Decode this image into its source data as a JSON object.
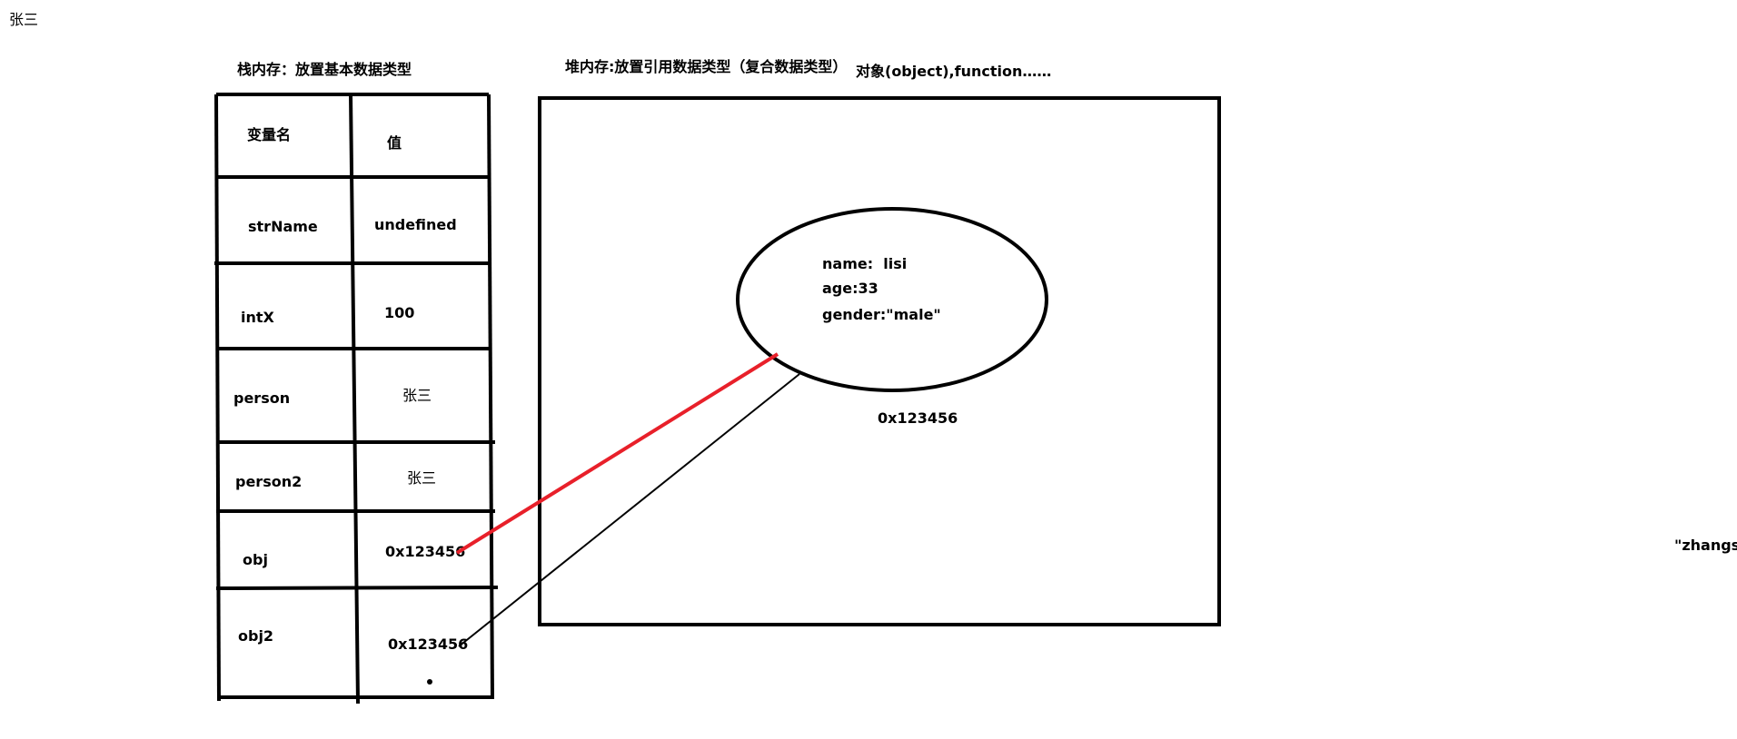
{
  "corner_note": "张三",
  "stack": {
    "title": "栈内存：放置基本数据类型",
    "header": {
      "name": "变量名",
      "value": "值"
    },
    "rows": [
      {
        "name": "strName",
        "value": "undefined"
      },
      {
        "name": "intX",
        "value": "100"
      },
      {
        "name": "person",
        "value": "张三"
      },
      {
        "name": "person2",
        "value": "张三"
      },
      {
        "name": "obj",
        "value": "0x123456"
      },
      {
        "name": "obj2",
        "value": "0x123456"
      }
    ]
  },
  "heap": {
    "title": "堆内存:放置引用数据类型（复合数据类型）",
    "title_extra": "对象(object),function……",
    "object": {
      "lines": [
        "name:  lisi",
        "age:33",
        "gender:\"male\""
      ],
      "address": "0x123456"
    }
  },
  "edge_text": "\"zhangsan",
  "colors": {
    "line": "#000000",
    "pointer": "#e8202a",
    "background": "#ffffff"
  }
}
